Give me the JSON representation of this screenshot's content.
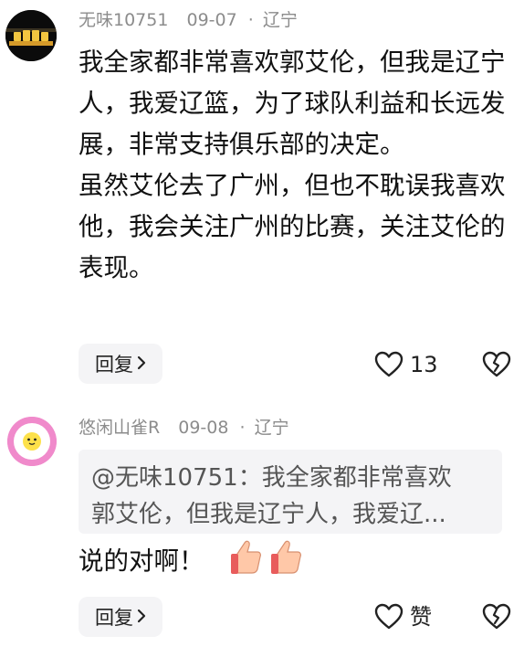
{
  "comment1": {
    "username": "无味10751",
    "date": "09-07",
    "location": "辽宁",
    "paragraphs": [
      "我全家都非常喜欢郭艾伦，但我是辽宁人，我爱辽篮，为了球队利益和长远发展，非常支持俱乐部的决定。",
      "虽然艾伦去了广州，但也不耽误我喜欢他，我会关注广州的比赛，关注艾伦的表现。"
    ],
    "reply_label": "回复",
    "like_count": "13"
  },
  "comment2": {
    "username": "悠闲山雀R",
    "date": "09-08",
    "location": "辽宁",
    "quote_line1": "@无味10751：我全家都非常喜欢",
    "quote_line2": "郭艾伦，但我是辽宁人，我爱辽...",
    "text": "说的对啊！",
    "reply_label": "回复",
    "like_label": "赞"
  },
  "icons": {
    "heart": "heart-outline-icon",
    "dislike": "broken-heart-icon",
    "thumbs": "thumbs-up-emoji",
    "chevron": "chevron-right-icon"
  },
  "colors": {
    "meta_text": "#8c8c8c",
    "button_bg": "#f4f4f6",
    "avatar2_ring": "#f08acb"
  }
}
